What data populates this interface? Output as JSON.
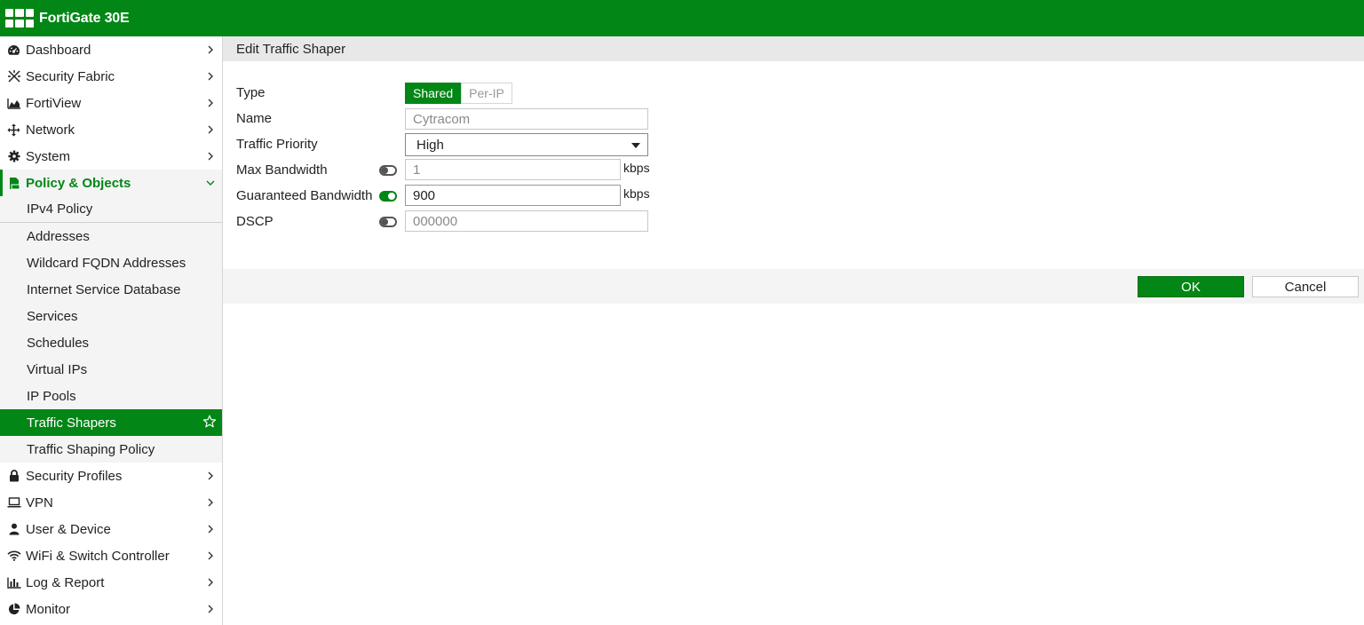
{
  "header": {
    "title": "FortiGate 30E",
    "logo_icon": "fortinet-logo-icon"
  },
  "sidebar": {
    "top_items": [
      {
        "label": "Dashboard",
        "icon": "dashboard-icon"
      },
      {
        "label": "Security Fabric",
        "icon": "security-fabric-icon"
      },
      {
        "label": "FortiView",
        "icon": "fortiview-chart-icon"
      },
      {
        "label": "Network",
        "icon": "network-arrows-icon"
      },
      {
        "label": "System",
        "icon": "gear-icon"
      }
    ],
    "open_section": {
      "label": "Policy & Objects",
      "icon": "policy-objects-icon"
    },
    "sub_items": [
      "IPv4 Policy",
      "Addresses",
      "Wildcard FQDN Addresses",
      "Internet Service Database",
      "Services",
      "Schedules",
      "Virtual IPs",
      "IP Pools",
      "Traffic Shapers",
      "Traffic Shaping Policy"
    ],
    "active_sub_index": 8,
    "bottom_items": [
      {
        "label": "Security Profiles",
        "icon": "lock-icon"
      },
      {
        "label": "VPN",
        "icon": "laptop-icon"
      },
      {
        "label": "User & Device",
        "icon": "user-icon"
      },
      {
        "label": "WiFi & Switch Controller",
        "icon": "wifi-icon"
      },
      {
        "label": "Log & Report",
        "icon": "bar-chart-icon"
      },
      {
        "label": "Monitor",
        "icon": "pie-chart-icon"
      }
    ]
  },
  "panel": {
    "title": "Edit Traffic Shaper",
    "form": {
      "type": {
        "label": "Type",
        "options": [
          "Shared",
          "Per-IP"
        ],
        "selected": "Shared"
      },
      "name": {
        "label": "Name",
        "placeholder": "Cytracom"
      },
      "traffic_priority": {
        "label": "Traffic Priority",
        "value": "High"
      },
      "max_bandwidth": {
        "label": "Max Bandwidth",
        "enabled": false,
        "placeholder": "1",
        "unit": "kbps"
      },
      "guaranteed_bandwidth": {
        "label": "Guaranteed Bandwidth",
        "enabled": true,
        "value": "900",
        "unit": "kbps"
      },
      "dscp": {
        "label": "DSCP",
        "enabled": false,
        "placeholder": "000000"
      }
    },
    "footer": {
      "ok_label": "OK",
      "cancel_label": "Cancel"
    }
  },
  "colors": {
    "brand_green": "#028616"
  }
}
